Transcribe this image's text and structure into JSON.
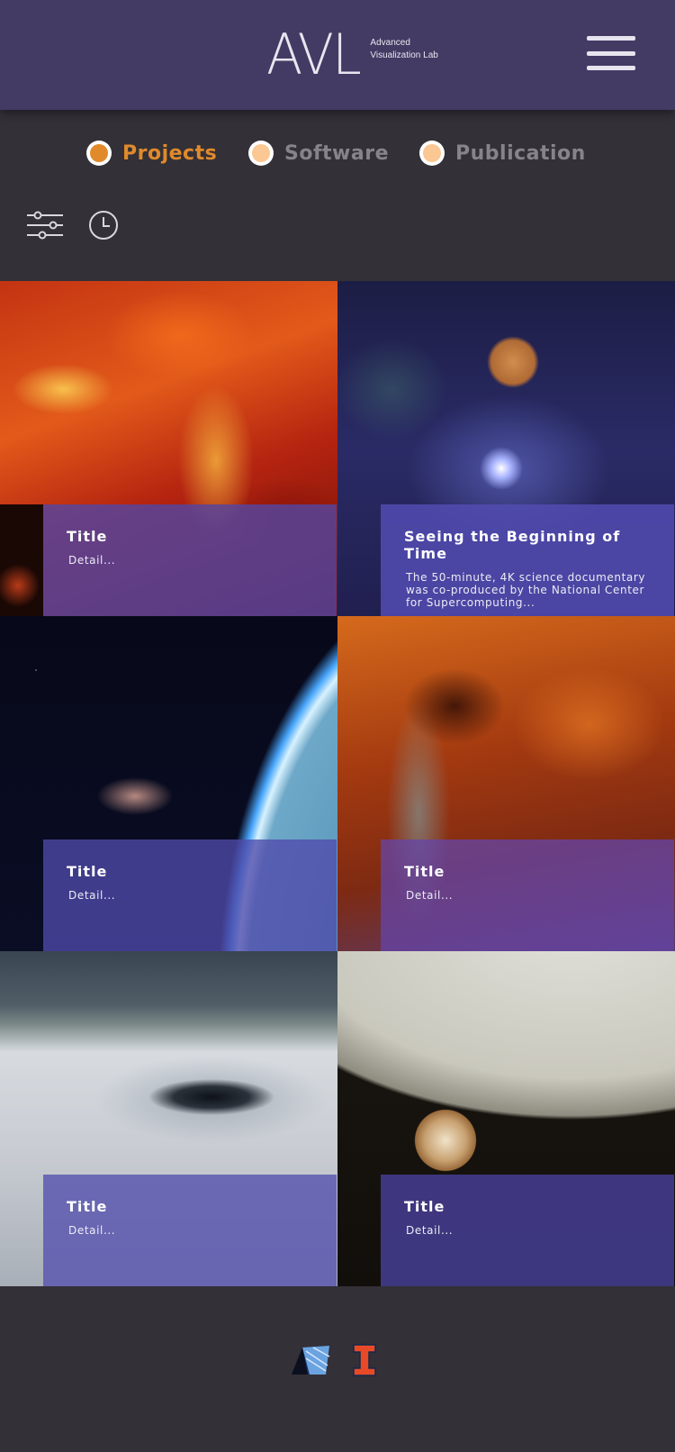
{
  "header": {
    "logo_main": "AVL",
    "logo_line1": "Advanced",
    "logo_line2": "Visualization Lab",
    "menu_icon": "hamburger-menu-icon"
  },
  "tabs": [
    {
      "label": "Projects",
      "selected": true
    },
    {
      "label": "Software",
      "selected": false
    },
    {
      "label": "Publication",
      "selected": false
    }
  ],
  "tools": {
    "filter_icon": "sliders-filter-icon",
    "history_icon": "clock-icon"
  },
  "projects": [
    {
      "title": "Title",
      "detail": "Detail..."
    },
    {
      "title": "Seeing the Beginning of Time",
      "detail": "The 50-minute, 4K science documentary was co-produced by the National Center for Supercomputing..."
    },
    {
      "title": "Title",
      "detail": "Detail..."
    },
    {
      "title": "Title",
      "detail": "Detail..."
    },
    {
      "title": "Title",
      "detail": "Detail..."
    },
    {
      "title": "Title",
      "detail": "Detail..."
    }
  ],
  "footer": {
    "logos": [
      "blue-waters-logo",
      "illinois-block-i-logo"
    ]
  },
  "colors": {
    "header_bg": "#433b64",
    "page_bg": "#333037",
    "accent_orange": "#e08a2b",
    "radio_inactive": "#fbc792",
    "caption_overlay": "#504aaa"
  }
}
